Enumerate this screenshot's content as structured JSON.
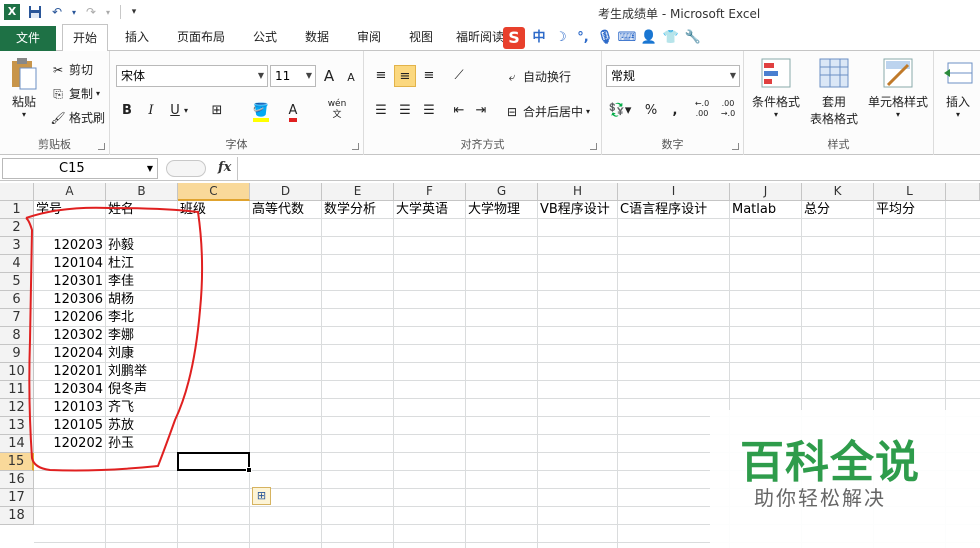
{
  "window": {
    "title": "考生成绩单 - Microsoft Excel",
    "app_icon": "X"
  },
  "quick_access": {
    "save_icon": "save-icon",
    "undo_icon": "undo-icon",
    "redo_icon": "redo-icon",
    "custom_icon": "customize-icon"
  },
  "tabs": [
    "文件",
    "开始",
    "插入",
    "页面布局",
    "公式",
    "数据",
    "审阅",
    "视图",
    "福昕阅读"
  ],
  "ribbon": {
    "clipboard": {
      "label": "剪贴板",
      "paste": "粘贴",
      "cut": "剪切",
      "copy": "复制",
      "format_painter": "格式刷"
    },
    "font": {
      "label": "字体",
      "name": "宋体",
      "size": "11",
      "bold": "B",
      "italic": "I",
      "underline": "U",
      "grow": "A",
      "shrink": "A",
      "wen": "wén 文"
    },
    "alignment": {
      "label": "对齐方式",
      "wrap": "自动换行",
      "merge": "合并后居中"
    },
    "number": {
      "label": "数字",
      "format": "常规",
      "percent": "%",
      "comma": ",",
      "inc": "←.0 .00",
      "dec": ".00 →.0"
    },
    "styles": {
      "label": "样式",
      "conditional": "条件格式",
      "table_format_1": "套用",
      "table_format_2": "表格格式",
      "cell_styles": "单元格样式"
    },
    "cells": {
      "insert": "插入"
    }
  },
  "formula_bar": {
    "name_box": "C15",
    "fx": "fx",
    "value": ""
  },
  "columns": [
    "A",
    "B",
    "C",
    "D",
    "E",
    "F",
    "G",
    "H",
    "I",
    "J",
    "K",
    "L"
  ],
  "rows": [
    "1",
    "2",
    "3",
    "4",
    "5",
    "6",
    "7",
    "8",
    "9",
    "10",
    "11",
    "12",
    "13",
    "14",
    "15",
    "16",
    "17",
    "18"
  ],
  "header_row": [
    "学号",
    "姓名",
    "班级",
    "高等代数",
    "数学分析",
    "大学英语",
    "大学物理",
    "VB程序设计",
    "C语言程序设计",
    "Matlab",
    "总分",
    "平均分"
  ],
  "records": [
    {
      "id": "120203",
      "name": "孙毅"
    },
    {
      "id": "120104",
      "name": "杜江"
    },
    {
      "id": "120301",
      "name": "李佳"
    },
    {
      "id": "120306",
      "name": "胡杨"
    },
    {
      "id": "120206",
      "name": "李北"
    },
    {
      "id": "120302",
      "name": "李娜"
    },
    {
      "id": "120204",
      "name": "刘康"
    },
    {
      "id": "120201",
      "name": "刘鹏举"
    },
    {
      "id": "120304",
      "name": "倪冬声"
    },
    {
      "id": "120103",
      "name": "齐飞"
    },
    {
      "id": "120105",
      "name": "苏放"
    },
    {
      "id": "120202",
      "name": "孙玉"
    }
  ],
  "selection": {
    "cell": "C15",
    "column": "C",
    "row": "15"
  },
  "annotation_color": "#e02020",
  "watermark": {
    "title": "百科全说",
    "subtitle": "助你轻松解决"
  }
}
